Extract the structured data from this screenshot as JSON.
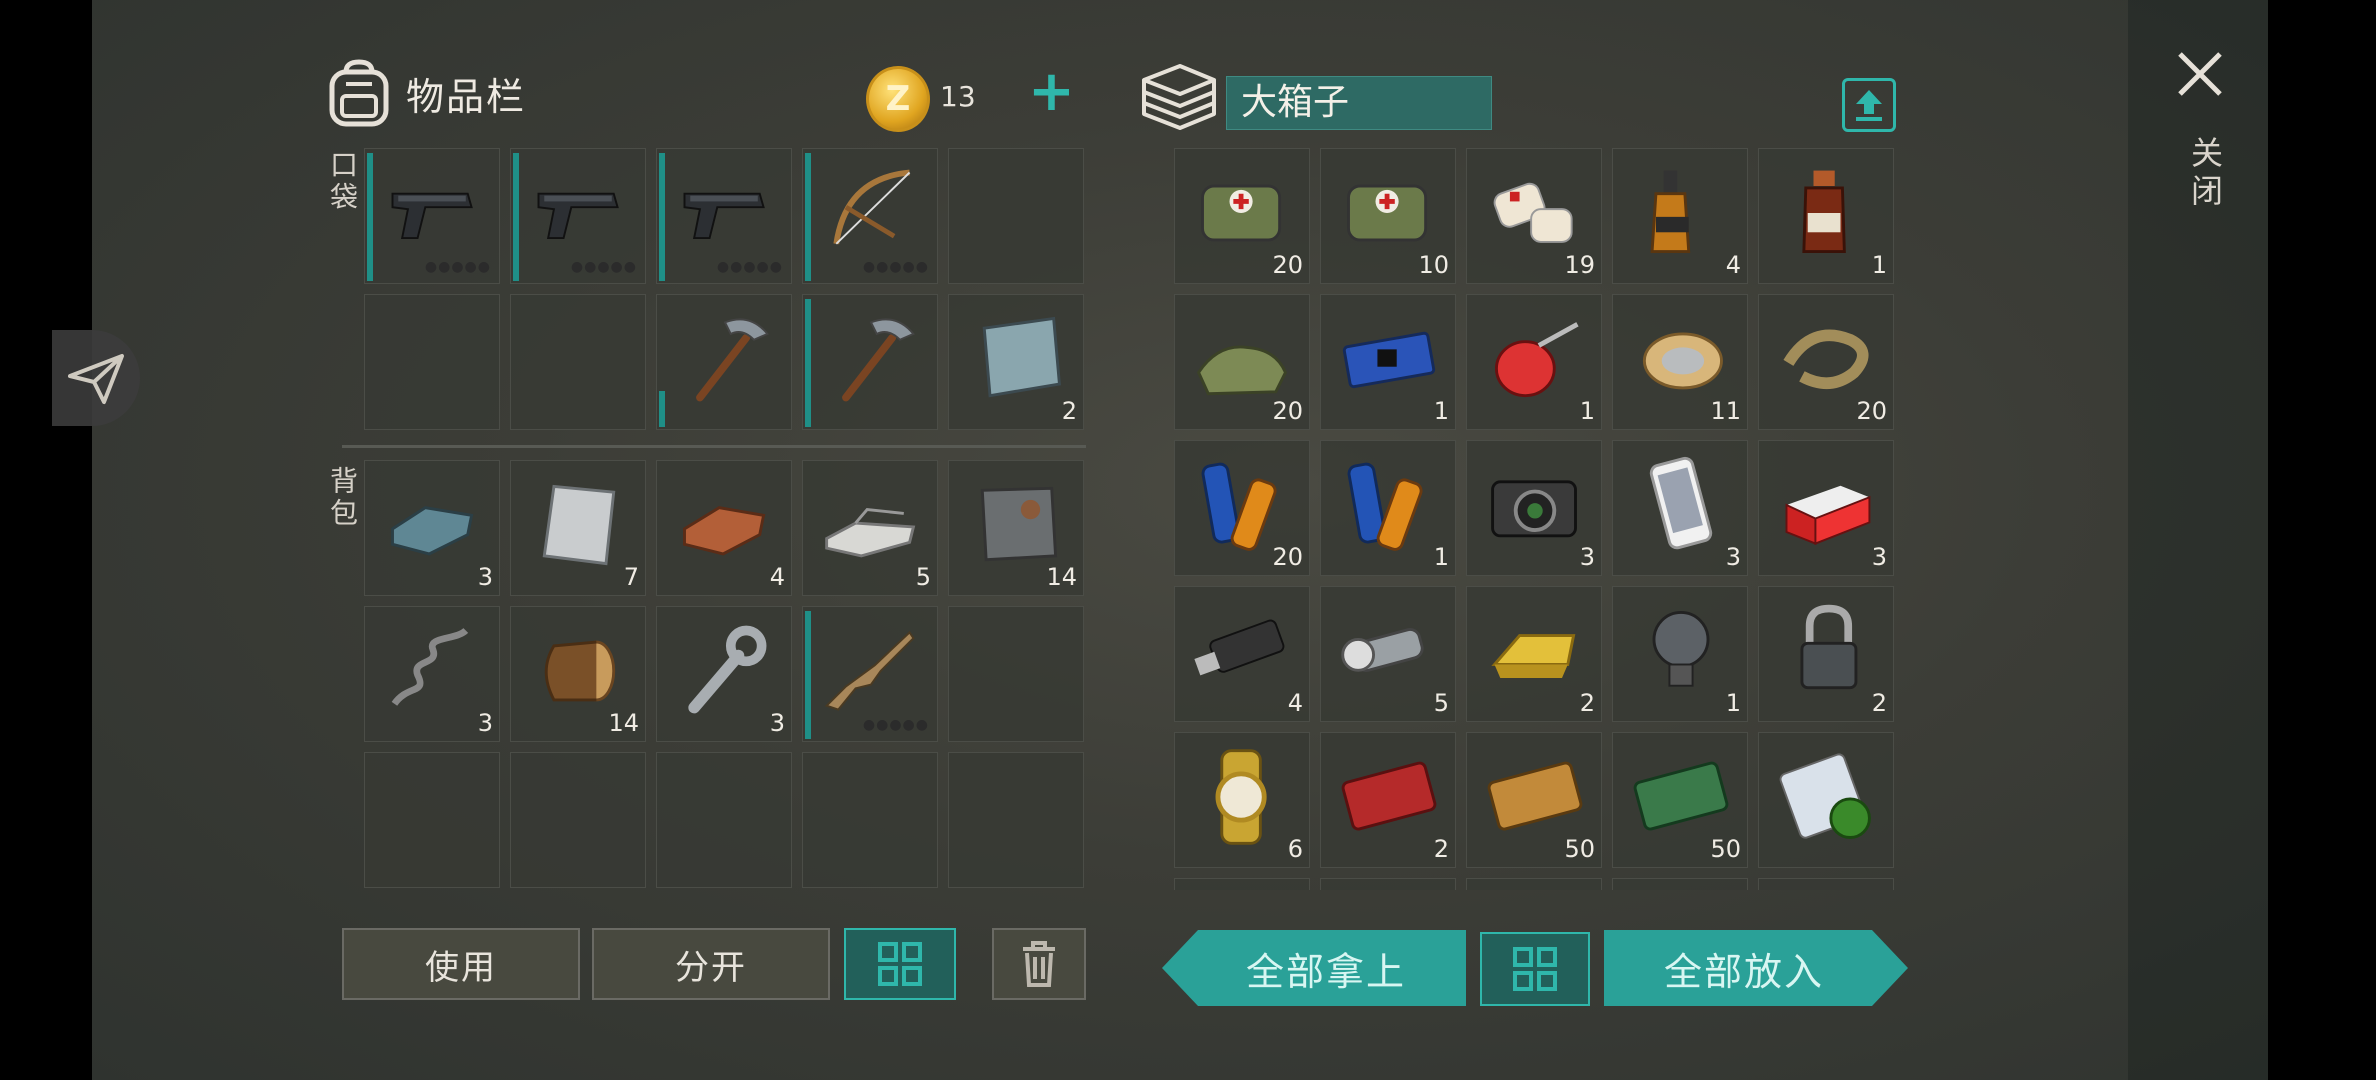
{
  "inventory": {
    "title": "物品栏",
    "pocket_label": "口袋",
    "backpack_label": "背包",
    "coins": "13",
    "coin_symbol": "Z",
    "add_symbol": "+",
    "pocket": [
      {
        "icon": "pistol-icon",
        "qty": "",
        "durability": true,
        "dots": "●●●●●"
      },
      {
        "icon": "pistol-icon",
        "qty": "",
        "durability": true,
        "dots": "●●●●●"
      },
      {
        "icon": "pistol-icon",
        "qty": "",
        "durability": true,
        "dots": "●●●●●"
      },
      {
        "icon": "crossbow-icon",
        "qty": "",
        "durability": true,
        "dots": "●●●●●"
      },
      {
        "icon": "",
        "qty": ""
      },
      {
        "icon": "",
        "qty": ""
      },
      {
        "icon": "",
        "qty": ""
      },
      {
        "icon": "pickaxe-icon",
        "qty": "",
        "durability": "low"
      },
      {
        "icon": "pickaxe-icon",
        "qty": "",
        "durability": true
      },
      {
        "icon": "steel-plate-icon",
        "qty": "2"
      }
    ],
    "backpack": [
      {
        "icon": "iron-ingot-icon",
        "qty": "3"
      },
      {
        "icon": "aluminum-plate-icon",
        "qty": "7"
      },
      {
        "icon": "copper-ingot-icon",
        "qty": "4"
      },
      {
        "icon": "tin-bars-icon",
        "qty": "5"
      },
      {
        "icon": "rusty-plate-icon",
        "qty": "14"
      },
      {
        "icon": "spring-icon",
        "qty": "3"
      },
      {
        "icon": "log-icon",
        "qty": "14"
      },
      {
        "icon": "wrench-icon",
        "qty": "3"
      },
      {
        "icon": "assault-rifle-icon",
        "qty": "",
        "durability": true,
        "dots": "●●●●●"
      },
      {
        "icon": "",
        "qty": ""
      },
      {
        "icon": "",
        "qty": ""
      },
      {
        "icon": "",
        "qty": ""
      },
      {
        "icon": "",
        "qty": ""
      },
      {
        "icon": "",
        "qty": ""
      },
      {
        "icon": "",
        "qty": ""
      }
    ]
  },
  "chest": {
    "name": "大箱子",
    "items": [
      {
        "icon": "medkit-bag-icon",
        "qty": "20"
      },
      {
        "icon": "medkit-bag-icon",
        "qty": "10"
      },
      {
        "icon": "bandage-icon",
        "qty": "19"
      },
      {
        "icon": "whiskey-icon",
        "qty": "4"
      },
      {
        "icon": "medicine-bottle-icon",
        "qty": "1"
      },
      {
        "icon": "cloth-icon",
        "qty": "20"
      },
      {
        "icon": "circuit-board-icon",
        "qty": "1"
      },
      {
        "icon": "oil-can-icon",
        "qty": "1"
      },
      {
        "icon": "wire-spool-icon",
        "qty": "11"
      },
      {
        "icon": "rope-icon",
        "qty": "20"
      },
      {
        "icon": "batteries-icon",
        "qty": "20"
      },
      {
        "icon": "batteries-icon",
        "qty": "1"
      },
      {
        "icon": "camera-icon",
        "qty": "3"
      },
      {
        "icon": "smartphone-icon",
        "qty": "3"
      },
      {
        "icon": "cigarettes-icon",
        "qty": "3"
      },
      {
        "icon": "usb-drive-icon",
        "qty": "4"
      },
      {
        "icon": "flashlight-icon",
        "qty": "5"
      },
      {
        "icon": "gold-bar-icon",
        "qty": "2"
      },
      {
        "icon": "light-bulb-icon",
        "qty": "1"
      },
      {
        "icon": "padlock-icon",
        "qty": "2"
      },
      {
        "icon": "gold-watch-icon",
        "qty": "6"
      },
      {
        "icon": "combat-coupon-icon",
        "qty": "2"
      },
      {
        "icon": "survival-coupon-icon",
        "qty": "50"
      },
      {
        "icon": "ration-coupon-icon",
        "qty": "50"
      },
      {
        "icon": "biohazard-blueprint-icon",
        "qty": ""
      }
    ]
  },
  "buttons": {
    "use": "使用",
    "split": "分开",
    "take_all": "全部拿上",
    "put_all": "全部放入",
    "close": "关闭"
  },
  "colors": {
    "accent": "#2fb7ab",
    "accent_dark": "#22605a",
    "chest_name_bg": "#2e6a64",
    "coin_gold": "#e0a520"
  }
}
